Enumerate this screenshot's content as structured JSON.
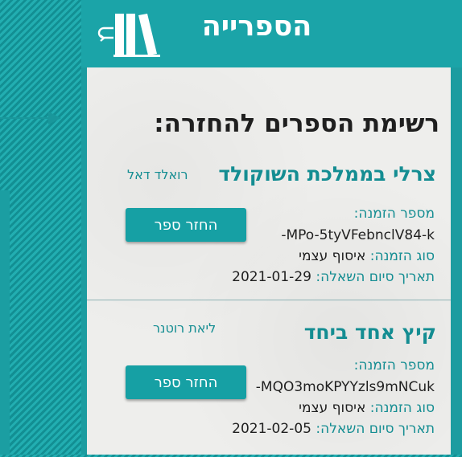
{
  "header": {
    "title": "הספרייה"
  },
  "page": {
    "title": "רשימת הספרים להחזרה:"
  },
  "books": [
    {
      "title": "צרלי בממלכת השוקולד",
      "author": "רואלד דאל",
      "return_button": "החזר ספר",
      "order_number_label": "מספר הזמנה:",
      "order_number": "-MPo-5tyVFebnclV84-k",
      "order_type_label": "סוג הזמנה:",
      "order_type": "איסוף עצמי",
      "end_date_label": "תאריך סיום השאלה:",
      "end_date": "2021-01-29"
    },
    {
      "title": "קיץ אחד ביחד",
      "author": "ליאת רוטנר",
      "return_button": "החזר ספר",
      "order_number_label": "מספר הזמנה:",
      "order_number": "-MQO3moKPYYzls9mNCuk",
      "order_type_label": "סוג הזמנה:",
      "order_type": "איסוף עצמי",
      "end_date_label": "תאריך סיום השאלה:",
      "end_date": "2021-02-05"
    }
  ],
  "colors": {
    "accent": "#16a0a4",
    "text_accent": "#148d92",
    "background": "#eeeeec"
  },
  "icons": {
    "back": "back-arrow-icon",
    "logo": "library-books-icon",
    "annotation": "arrow-icon"
  }
}
